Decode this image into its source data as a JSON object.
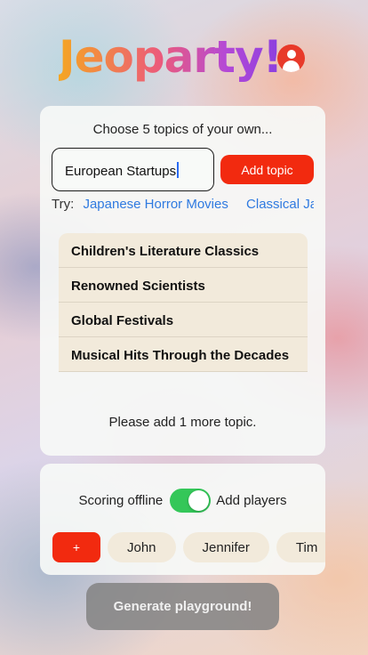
{
  "app": {
    "logo_text": "Jeoparty!"
  },
  "topics_card": {
    "title": "Choose 5 topics of your own...",
    "input_value": "European Startups",
    "add_button": "Add topic",
    "try_label": "Try:",
    "suggestions": [
      "Japanese Horror Movies",
      "Classical Japanese Poetry"
    ],
    "topics": [
      "Children's Literature Classics",
      "Renowned Scientists",
      "Global Festivals",
      "Musical Hits Through the Decades"
    ],
    "hint": "Please add 1 more topic."
  },
  "players_card": {
    "scoring_label": "Scoring offline",
    "toggle_on": true,
    "add_players_label": "Add players",
    "add_button": "+",
    "players": [
      "John",
      "Jennifer",
      "Tim"
    ]
  },
  "generate_button": "Generate playground!",
  "colors": {
    "accent": "#f22a0f",
    "toggle": "#34c759",
    "link": "#2f7ae0",
    "chip": "#f2eadb"
  }
}
